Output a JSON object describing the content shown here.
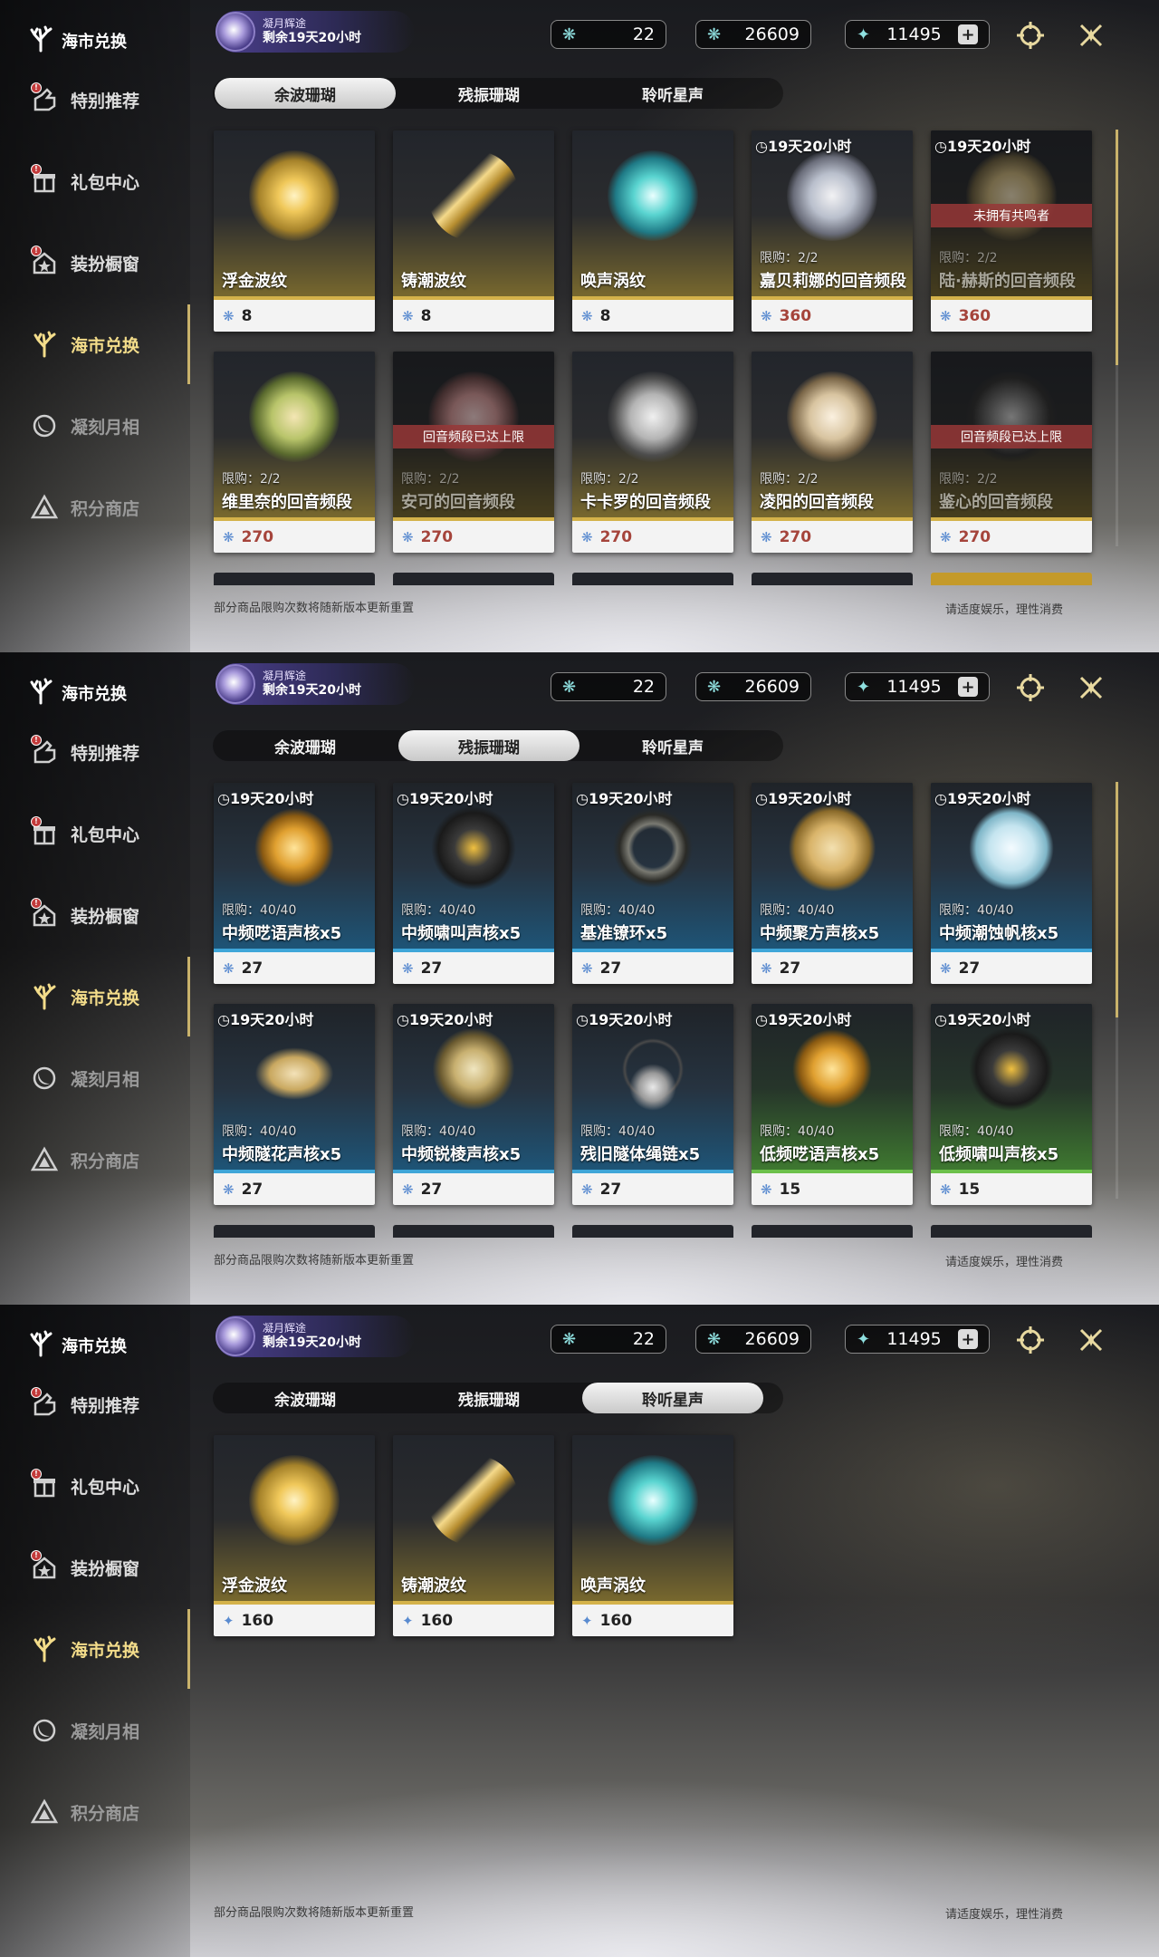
{
  "shared": {
    "sidebar_title": "海市兑换",
    "sidebar_items": [
      {
        "label": "特别推荐",
        "icon": "special-recommend-icon",
        "badge": "!"
      },
      {
        "label": "礼包中心",
        "icon": "gift-box-icon",
        "badge": "!"
      },
      {
        "label": "装扮橱窗",
        "icon": "wardrobe-house-icon",
        "badge": "!"
      },
      {
        "label": "海市兑换",
        "icon": "coral-tree-icon",
        "active": true
      },
      {
        "label": "凝刻月相",
        "icon": "moon-phase-icon"
      },
      {
        "label": "积分商店",
        "icon": "points-triangle-icon"
      }
    ],
    "event": {
      "name": "凝月辉途",
      "remaining": "剩余19天20小时"
    },
    "currencies": [
      {
        "icon": "coral-currency-icon",
        "value": "22"
      },
      {
        "icon": "wave-coral-icon",
        "value": "26609"
      },
      {
        "icon": "star-sound-icon",
        "value": "11495",
        "plus": "+"
      }
    ],
    "tabs": [
      "余波珊瑚",
      "残振珊瑚",
      "聆听星声"
    ],
    "note_left": "部分商品限购次数将随新版本更新重置",
    "note_right": "请适度娱乐，理性消费"
  },
  "panels": [
    {
      "selected_tab": 0,
      "cards": [
        {
          "name": "浮金波纹",
          "price": "8",
          "theme": "gold",
          "art": "gold-orb"
        },
        {
          "name": "铸潮波纹",
          "price": "8",
          "theme": "gold",
          "art": "gold-blade"
        },
        {
          "name": "唤声涡纹",
          "price": "8",
          "theme": "gold",
          "art": "teal-orb"
        },
        {
          "name": "嘉贝莉娜的回音频段",
          "price": "360",
          "theme": "gold",
          "art": "portrait-silver",
          "timer": "19天20小时",
          "limit": "限购：2/2",
          "red": true
        },
        {
          "name": "陆·赫斯的回音频段",
          "price": "360",
          "theme": "gold",
          "art": "portrait-blond",
          "timer": "19天20小时",
          "limit": "限购：2/2",
          "red": true,
          "banner": "未拥有共鸣者",
          "dim": true
        },
        {
          "name": "维里奈的回音频段",
          "price": "270",
          "theme": "gold",
          "art": "portrait-green",
          "limit": "限购：2/2",
          "red": true
        },
        {
          "name": "安可的回音频段",
          "price": "270",
          "theme": "gold",
          "art": "portrait-pink",
          "limit": "限购：2/2",
          "red": true,
          "banner": "回音频段已达上限",
          "dim": true
        },
        {
          "name": "卡卡罗的回音频段",
          "price": "270",
          "theme": "gold",
          "art": "portrait-white",
          "limit": "限购：2/2",
          "red": true
        },
        {
          "name": "凌阳的回音频段",
          "price": "270",
          "theme": "gold",
          "art": "portrait-lion",
          "limit": "限购：2/2",
          "red": true
        },
        {
          "name": "鉴心的回音频段",
          "price": "270",
          "theme": "gold",
          "art": "portrait-dark",
          "limit": "限购：2/2",
          "red": true,
          "banner": "回音频段已达上限",
          "dim": true
        }
      ]
    },
    {
      "selected_tab": 1,
      "cards": [
        {
          "name": "中频呓语声核x5",
          "price": "27",
          "theme": "blue",
          "art": "gold-star",
          "timer": "19天20小时",
          "limit": "限购：40/40"
        },
        {
          "name": "中频啸叫声核x5",
          "price": "27",
          "theme": "blue",
          "art": "dark-core",
          "timer": "19天20小时",
          "limit": "限购：40/40"
        },
        {
          "name": "基准镣环x5",
          "price": "27",
          "theme": "blue",
          "art": "ring",
          "timer": "19天20小时",
          "limit": "限购：40/40"
        },
        {
          "name": "中频聚方声核x5",
          "price": "27",
          "theme": "blue",
          "art": "hexagon",
          "timer": "19天20小时",
          "limit": "限购：40/40"
        },
        {
          "name": "中频潮蚀帆核x5",
          "price": "27",
          "theme": "blue",
          "art": "shell",
          "timer": "19天20小时",
          "limit": "限购：40/40"
        },
        {
          "name": "中频隧花声核x5",
          "price": "27",
          "theme": "blue",
          "art": "petals",
          "timer": "19天20小时",
          "limit": "限购：40/40"
        },
        {
          "name": "中频锐棱声核x5",
          "price": "27",
          "theme": "blue",
          "art": "triangle",
          "timer": "19天20小时",
          "limit": "限购：40/40"
        },
        {
          "name": "残旧隧体绳链x5",
          "price": "27",
          "theme": "blue",
          "art": "necklace",
          "timer": "19天20小时",
          "limit": "限购：40/40"
        },
        {
          "name": "低频呓语声核x5",
          "price": "15",
          "theme": "green",
          "art": "gold-star",
          "timer": "19天20小时",
          "limit": "限购：40/40"
        },
        {
          "name": "低频啸叫声核x5",
          "price": "15",
          "theme": "green",
          "art": "dark-core",
          "timer": "19天20小时",
          "limit": "限购：40/40"
        }
      ]
    },
    {
      "selected_tab": 2,
      "cards": [
        {
          "name": "浮金波纹",
          "price": "160",
          "theme": "gold",
          "art": "gold-orb",
          "fi": "star"
        },
        {
          "name": "铸潮波纹",
          "price": "160",
          "theme": "gold",
          "art": "gold-blade",
          "fi": "star"
        },
        {
          "name": "唤声涡纹",
          "price": "160",
          "theme": "gold",
          "art": "teal-orb",
          "fi": "star"
        }
      ]
    }
  ]
}
